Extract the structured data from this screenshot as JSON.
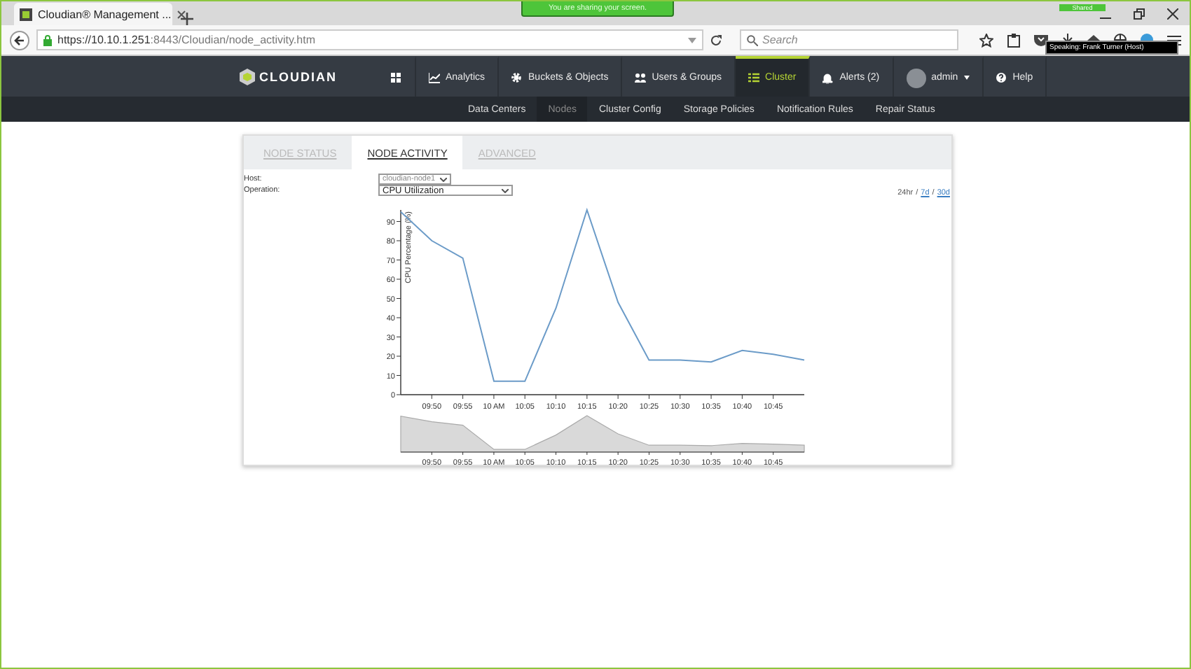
{
  "browser": {
    "tab_title": "Cloudian® Management ...",
    "url_host": "https://10.10.1.251",
    "url_path": ":8443/Cloudian/node_activity.htm",
    "search_placeholder": "Search"
  },
  "share_banner": "You are sharing your screen.",
  "shared_badge": "Shared",
  "speaking_tooltip": "Speaking: Frank Turner (Host)",
  "app_nav": {
    "logo": "CLOUDIAN",
    "items": [
      {
        "kind": "grid",
        "selected": false
      },
      {
        "kind": "chart",
        "label": "Analytics",
        "selected": false
      },
      {
        "kind": "gear",
        "label": "Buckets & Objects",
        "selected": false
      },
      {
        "kind": "users",
        "label": "Users & Groups",
        "selected": false
      },
      {
        "kind": "list",
        "label": "Cluster",
        "selected": true
      },
      {
        "kind": "bell",
        "label": "Alerts (2)",
        "selected": false
      },
      {
        "kind": "user",
        "label": "admin",
        "selected": false
      },
      {
        "kind": "help",
        "label": "Help",
        "selected": false
      }
    ]
  },
  "sub_nav": [
    {
      "label": "Data Centers",
      "selected": false
    },
    {
      "label": "Nodes",
      "selected": true
    },
    {
      "label": "Cluster Config",
      "selected": false
    },
    {
      "label": "Storage Policies",
      "selected": false
    },
    {
      "label": "Notification Rules",
      "selected": false
    },
    {
      "label": "Repair Status",
      "selected": false
    }
  ],
  "card_tabs": [
    {
      "label": "NODE STATUS",
      "selected": false
    },
    {
      "label": "NODE ACTIVITY",
      "selected": true
    },
    {
      "label": "ADVANCED",
      "selected": false
    }
  ],
  "form": [
    {
      "label": "Host:",
      "value": "cloudian-node1"
    },
    {
      "label": "Operation:",
      "value": "CPU Utilization"
    }
  ],
  "range": {
    "separator": "/",
    "options": [
      {
        "label": "24hr",
        "selected": true
      },
      {
        "label": "7d",
        "selected": false
      },
      {
        "label": "30d",
        "selected": false
      }
    ]
  },
  "chart_data": {
    "type": "line",
    "ylabel": "CPU Percentage (%)",
    "categories": [
      null,
      "09:50",
      "09:55",
      "10 AM",
      "10:05",
      "10:10",
      "10:15",
      "10:20",
      "10:25",
      "10:30",
      "10:35",
      "10:40",
      "10:45",
      null
    ],
    "series": [
      {
        "color": "#6b9bc8",
        "values": [
          95,
          80,
          71,
          7,
          7,
          45,
          96,
          48,
          18,
          18,
          17,
          23,
          21,
          18
        ]
      }
    ],
    "ylim": [
      0,
      96
    ],
    "yticks": [
      0,
      10,
      20,
      30,
      40,
      50,
      60,
      70,
      80,
      90
    ]
  },
  "navigator": {
    "xtick_labels": [
      "09:50",
      "09:55",
      "10 AM",
      "10:05",
      "10:10",
      "10:15",
      "10:20",
      "10:25",
      "10:30",
      "10:35",
      "10:40",
      "10:45"
    ]
  }
}
